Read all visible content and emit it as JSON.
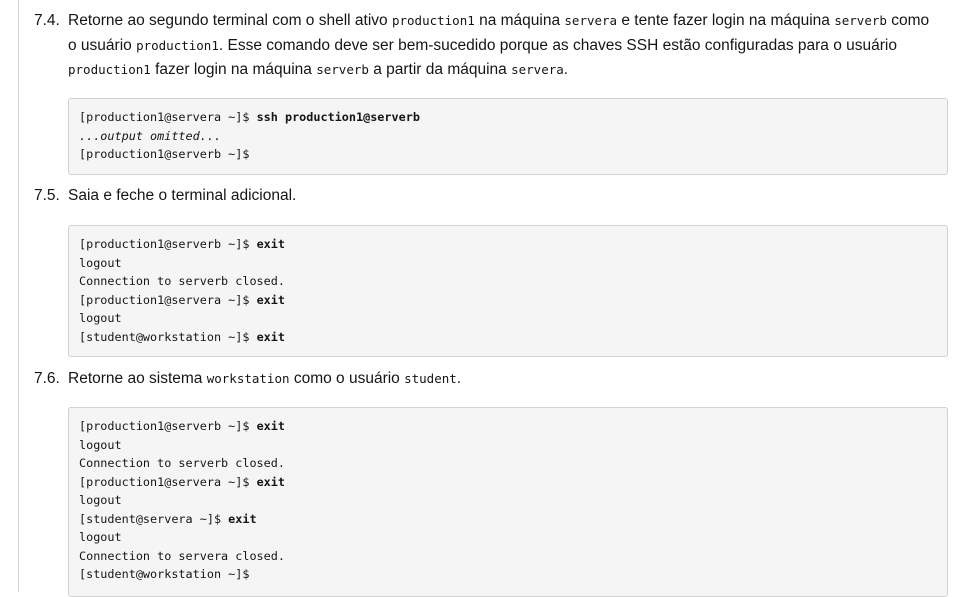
{
  "step_7_4": {
    "number": "7.4.",
    "t1": "Retorne ao segundo terminal com o shell ativo ",
    "c1": "production1",
    "t2": " na máquina ",
    "c2": "servera",
    "t3": " e tente fazer login na máquina ",
    "c3": "serverb",
    "t4": " como o usuário ",
    "c4": "production1",
    "t5": ". Esse comando deve ser bem-sucedido porque as chaves SSH estão configuradas para o usuário ",
    "c5": "production1",
    "t6": " fazer login na máquina ",
    "c6": "serverb",
    "t7": " a partir da máquina ",
    "c7": "servera",
    "t8": ".",
    "code": [
      {
        "prompt": "[production1@servera ~]$ ",
        "cmd": "ssh production1@serverb"
      },
      {
        "prompt": "...output omitted...",
        "cmd": ""
      },
      {
        "prompt": "[production1@serverb ~]$",
        "cmd": ""
      }
    ]
  },
  "step_7_5": {
    "number": "7.5.",
    "text": "Saia e feche o terminal adicional.",
    "code": [
      {
        "prompt": "[production1@serverb ~]$ ",
        "cmd": "exit"
      },
      {
        "prompt": "logout",
        "cmd": ""
      },
      {
        "prompt": "Connection to serverb closed.",
        "cmd": ""
      },
      {
        "prompt": "[production1@servera ~]$ ",
        "cmd": "exit"
      },
      {
        "prompt": "logout",
        "cmd": ""
      },
      {
        "prompt": "[student@workstation ~]$ ",
        "cmd": "exit"
      }
    ]
  },
  "step_7_6": {
    "number": "7.6.",
    "t1": "Retorne ao sistema ",
    "c1": "workstation",
    "t2": " como o usuário ",
    "c2": "student",
    "t3": ".",
    "code": [
      {
        "prompt": "[production1@serverb ~]$ ",
        "cmd": "exit"
      },
      {
        "prompt": "logout",
        "cmd": ""
      },
      {
        "prompt": "Connection to serverb closed.",
        "cmd": ""
      },
      {
        "prompt": "[production1@servera ~]$ ",
        "cmd": "exit"
      },
      {
        "prompt": "logout",
        "cmd": ""
      },
      {
        "prompt": "[student@servera ~]$ ",
        "cmd": "exit"
      },
      {
        "prompt": "logout",
        "cmd": ""
      },
      {
        "prompt": "Connection to servera closed.",
        "cmd": ""
      },
      {
        "prompt": "[student@workstation ~]$",
        "cmd": ""
      }
    ]
  }
}
